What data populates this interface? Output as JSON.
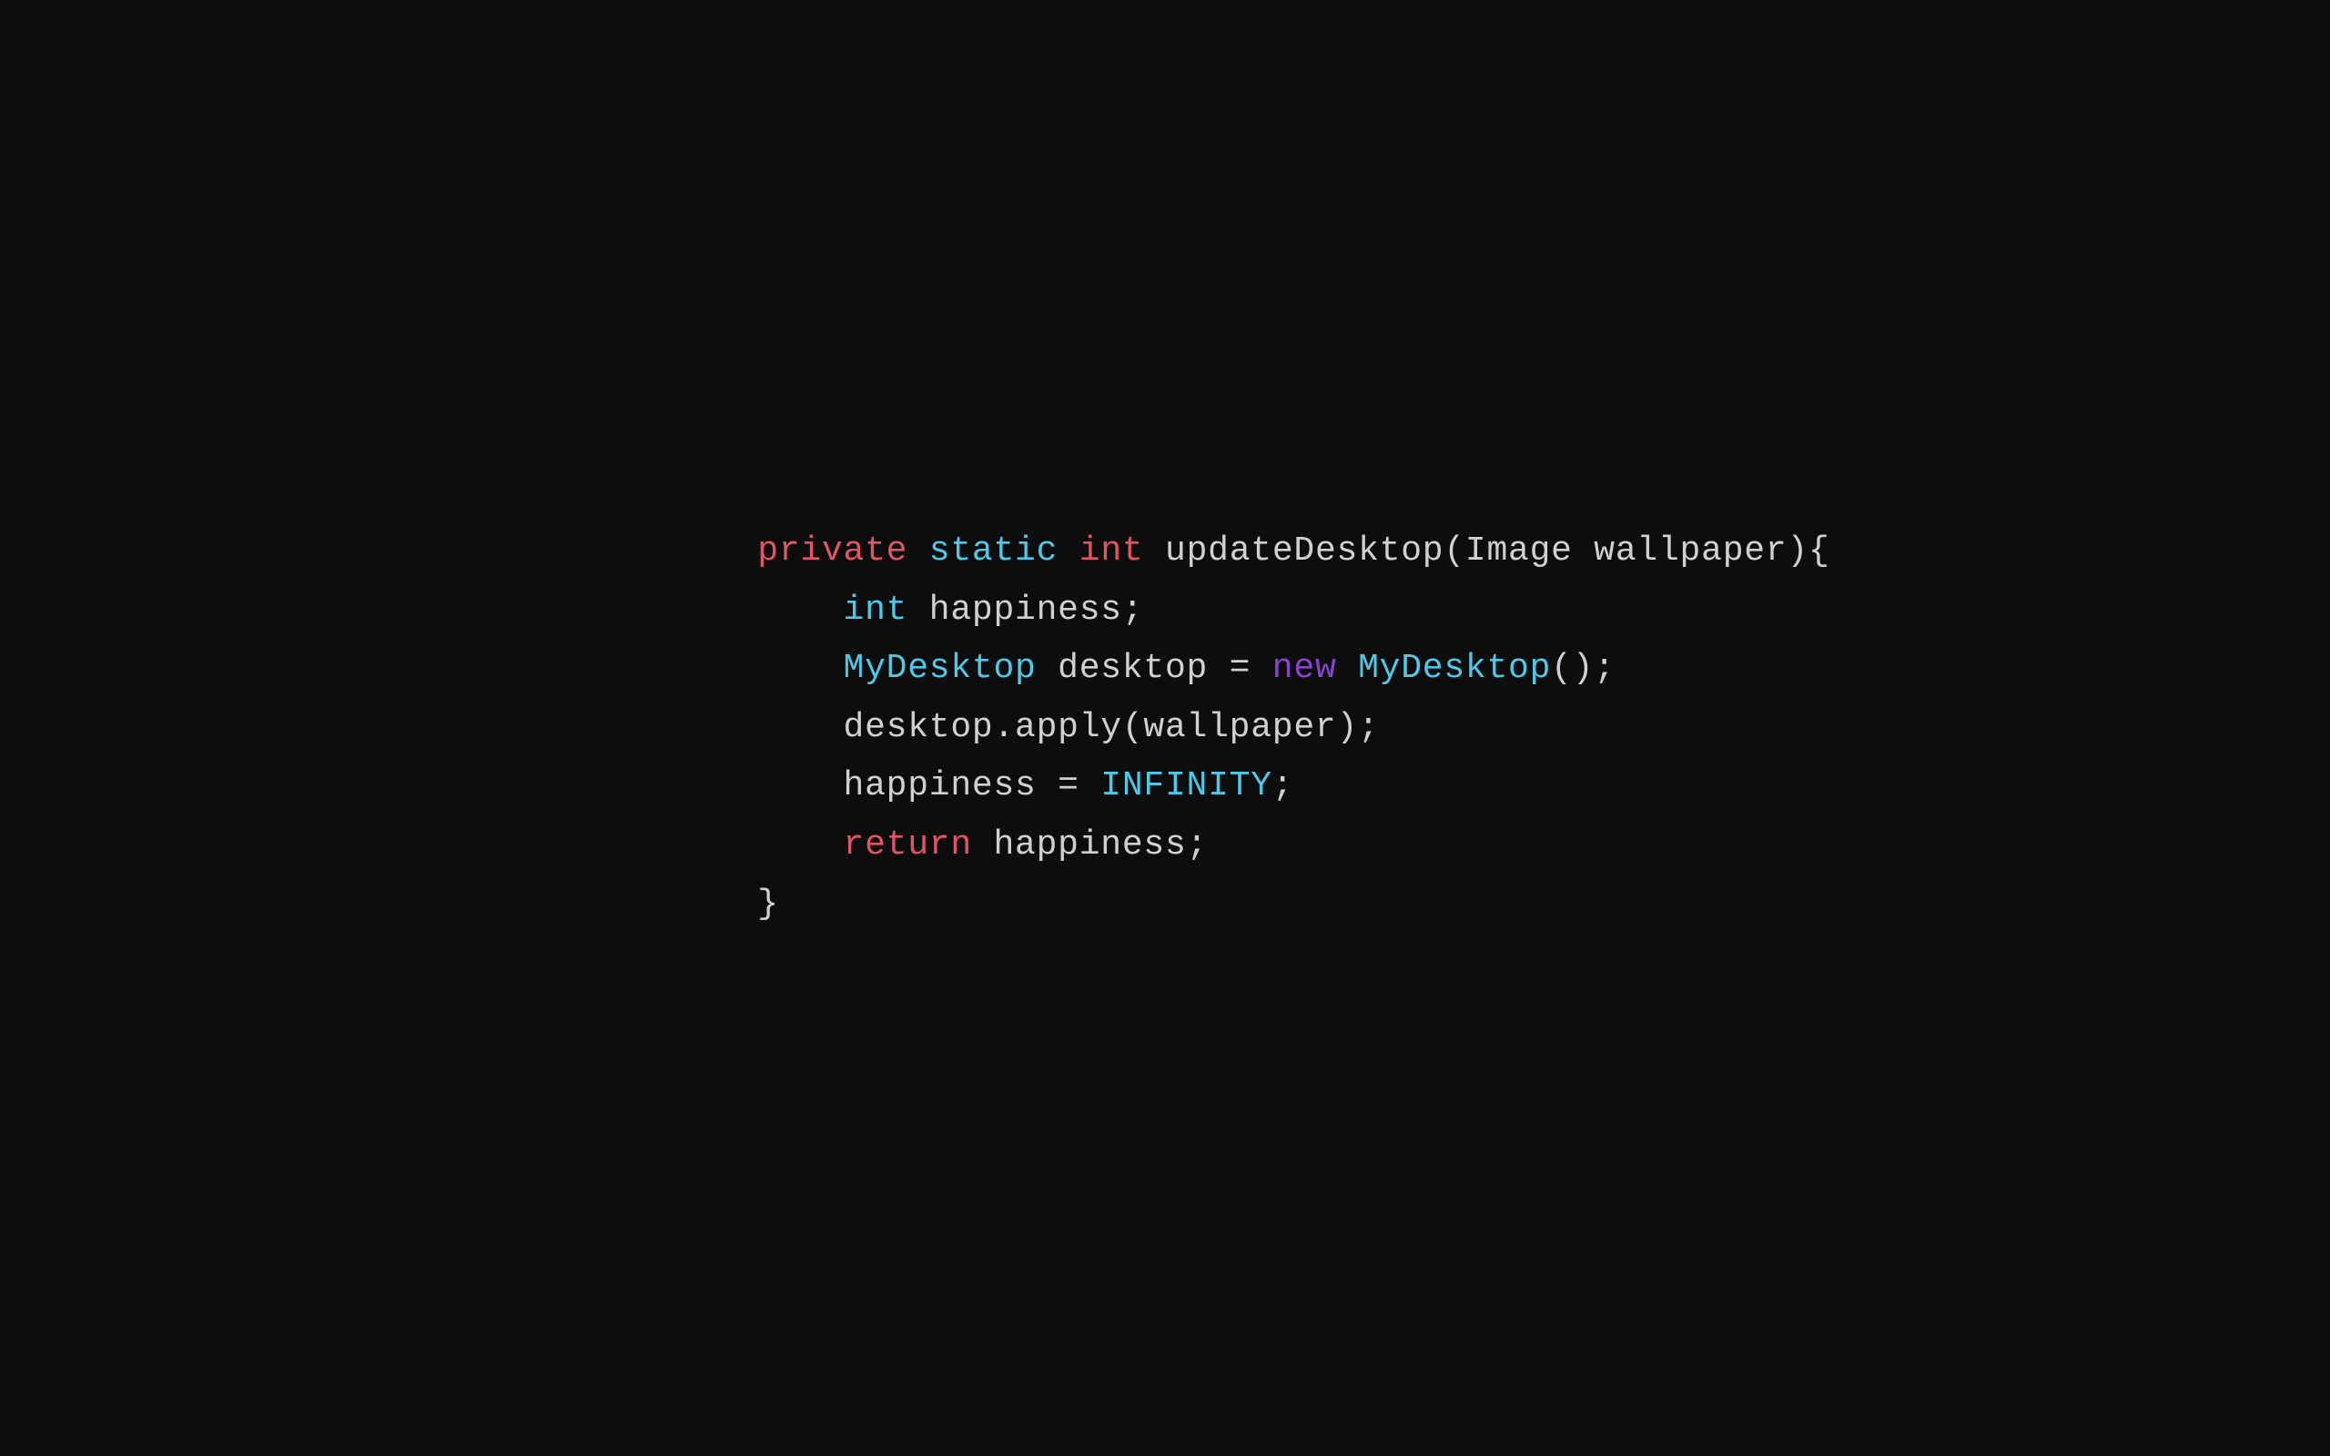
{
  "background": "#0d0d0d",
  "code": {
    "line1": {
      "private": "private",
      "static": "static",
      "int": "int",
      "rest": " updateDesktop(Image wallpaper){"
    },
    "line2": {
      "int": "int",
      "rest": " happiness;"
    },
    "line3": {
      "MyDesktop": "MyDesktop",
      "rest1": " desktop = ",
      "new": "new",
      "rest2": " MyDesktop();"
    },
    "line4": {
      "text": "desktop.apply(wallpaper);"
    },
    "line5": {
      "text1": "happiness = ",
      "INFINITY": "INFINITY",
      "text2": ";"
    },
    "line6": {
      "return": "return",
      "rest": " happiness;"
    },
    "line7": {
      "text": "}"
    }
  }
}
